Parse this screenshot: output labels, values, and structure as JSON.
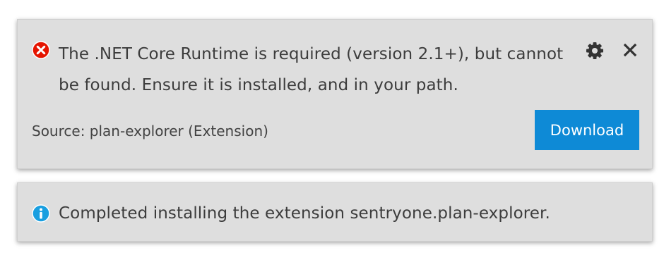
{
  "notifications": [
    {
      "severity": "error",
      "icon": "error-circle-icon",
      "message": "The .NET Core Runtime is required (version 2.1+), but cannot be found. Ensure it is installed, and in your path.",
      "source": "Source: plan-explorer (Extension)",
      "action_label": "Download",
      "settings_icon": "gear-icon",
      "close_icon": "close-icon"
    },
    {
      "severity": "info",
      "icon": "info-circle-icon",
      "message": "Completed installing the extension sentryone.plan-explorer."
    }
  ],
  "colors": {
    "toast_bg": "#dedede",
    "error": "#e51400",
    "info": "#1a9fe0",
    "button_bg": "#0e8ad6",
    "text": "#3c3c3c"
  }
}
